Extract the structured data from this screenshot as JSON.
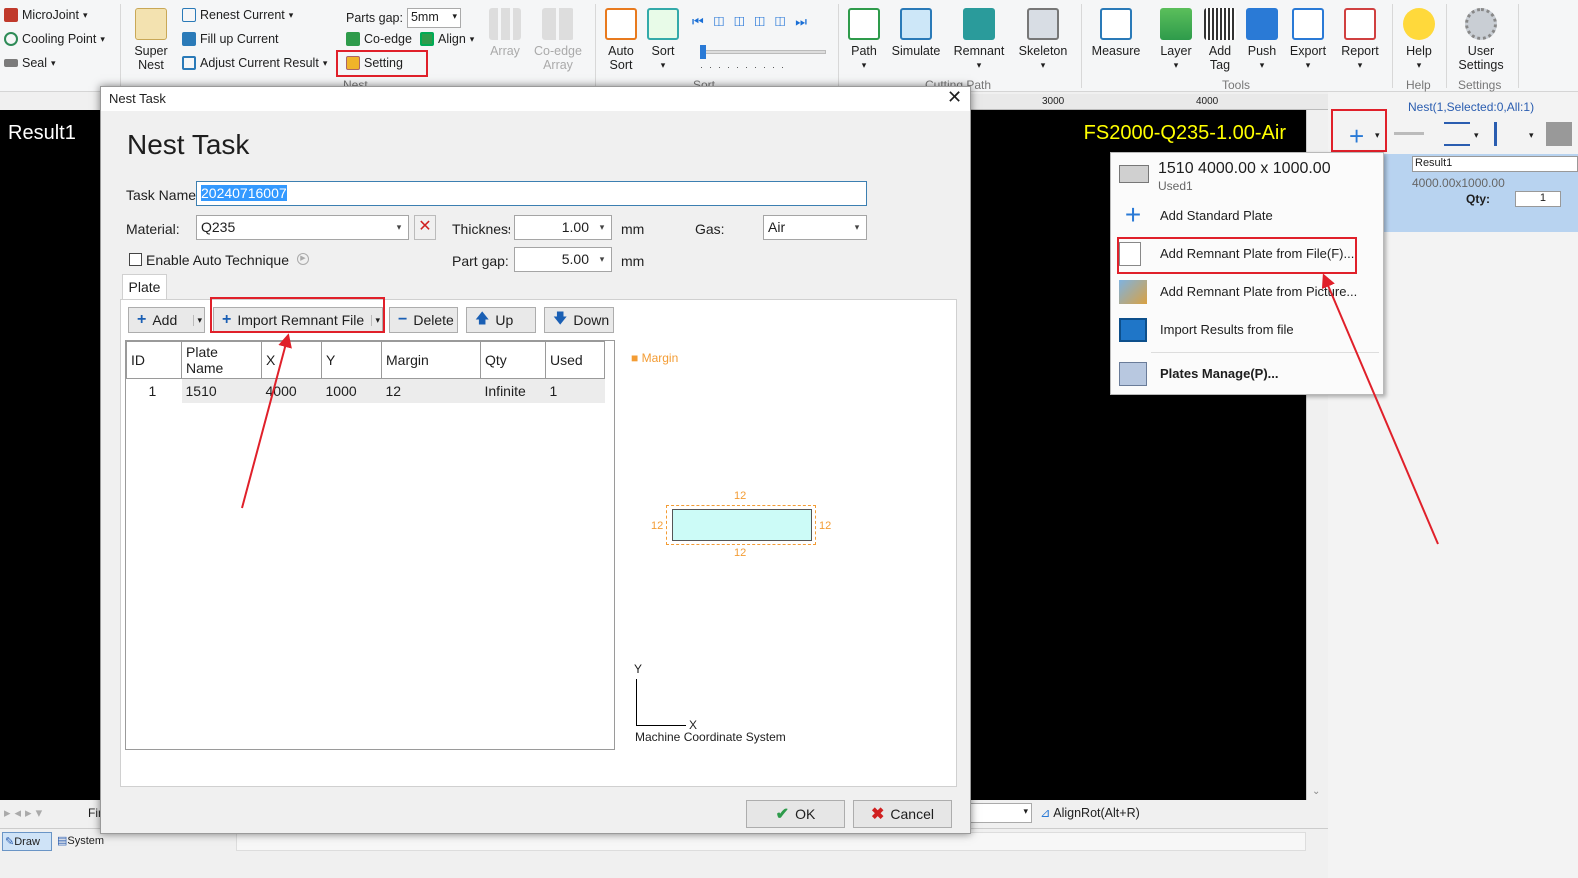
{
  "ribbon": {
    "left_items": [
      "MicroJoint",
      "Cooling Point",
      "Seal"
    ],
    "super_nest": "Super\nNest",
    "renest": [
      "Renest Current",
      "Fill up Current",
      "Adjust Current Result"
    ],
    "parts_gap_label": "Parts gap:",
    "parts_gap_value": "5mm",
    "coedge": "Co-edge",
    "align": "Align",
    "setting": "Setting",
    "array": "Array",
    "coedge_array": "Co-edge\nArray",
    "nest_group": "Nest",
    "auto_sort": "Auto\nSort",
    "sort": "Sort",
    "sort_group": "Sort",
    "path": "Path",
    "simulate": "Simulate",
    "remnant": "Remnant",
    "skeleton": "Skeleton",
    "cutting_path_group": "Cutting Path",
    "measure": "Measure",
    "layer": "Layer",
    "add_tag": "Add\nTag",
    "push": "Push",
    "export": "Export",
    "report": "Report",
    "tools_group": "Tools",
    "help": "Help",
    "help_group": "Help",
    "user_settings": "User\nSettings",
    "settings_group": "Settings"
  },
  "canvas": {
    "result_title": "Result1",
    "machine_label": "FS2000-Q235-1.00-Air",
    "ruler_3000": "3000",
    "ruler_4000": "4000"
  },
  "right_panel": {
    "nest_info": "Nest(1,Selected:0,All:1)",
    "result_name": "Result1",
    "plate_size": "4000.00x1000.00",
    "qty_label": "Qty:",
    "qty_value": "1"
  },
  "popup": {
    "plate_title": "1510 4000.00 x 1000.00",
    "plate_used": "Used1",
    "items": [
      "Add Standard Plate",
      "Add Remnant Plate from File(F)...",
      "Add Remnant Plate from Picture...",
      "Import Results from file",
      "Plates Manage(P)..."
    ]
  },
  "dialog": {
    "window_title": "Nest Task",
    "heading": "Nest Task",
    "task_name_label": "Task Name",
    "task_name_value": "20240716007",
    "material_label": "Material:",
    "material_value": "Q235",
    "thickness_label": "Thickness",
    "thickness_value": "1.00",
    "unit_mm": "mm",
    "gas_label": "Gas:",
    "gas_value": "Air",
    "auto_technique": "Enable Auto Technique",
    "part_gap_label": "Part gap:",
    "part_gap_value": "5.00",
    "tab_plate": "Plate",
    "btn_add": "Add",
    "btn_import": "Import Remnant File",
    "btn_delete": "Delete",
    "btn_up": "Up",
    "btn_down": "Down",
    "columns": [
      "ID",
      "Plate Name",
      "X",
      "Y",
      "Margin",
      "Qty",
      "Used"
    ],
    "rows": [
      [
        "1",
        "1510",
        "4000",
        "1000",
        "12",
        "Infinite",
        "1"
      ]
    ],
    "margin_legend": "Margin",
    "margin_value": "12",
    "axis_y": "Y",
    "axis_x": "X",
    "coord_system": "Machine Coordinate System",
    "ok": "OK",
    "cancel": "Cancel"
  },
  "statusbar": {
    "fin": "Fin",
    "alignrot": "AlignRot(Alt+R)",
    "tab_draw": "Draw",
    "tab_system": "System"
  },
  "colors": {
    "highlight": "#e0202a",
    "canvas_bg": "#000000",
    "machine_label": "#ffff00",
    "selection": "#3399ff",
    "margin": "#f39c34",
    "plate_fill": "#ccfbf7"
  }
}
